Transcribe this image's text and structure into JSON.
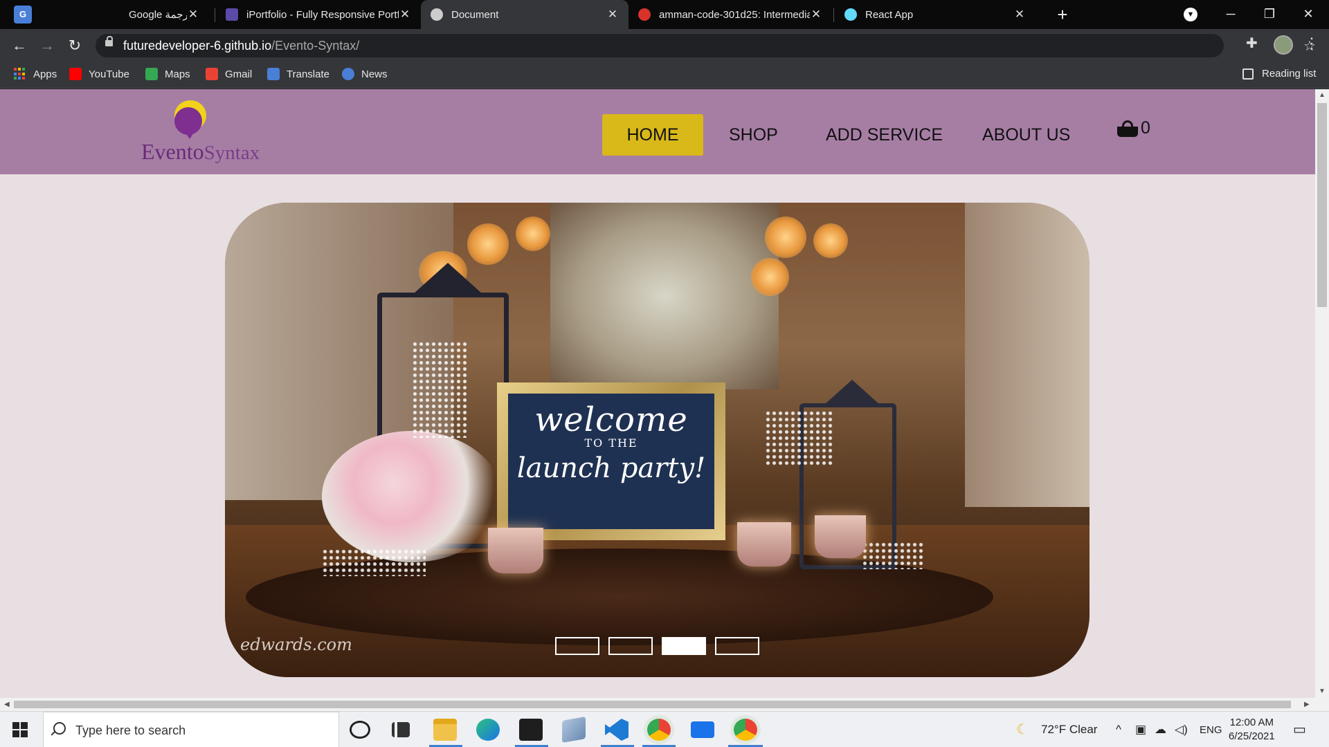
{
  "browser": {
    "tabs": [
      {
        "title": "Google ترجمة",
        "favicon": "translate-favicon",
        "color": "#4a7fd8"
      },
      {
        "title": "iPortfolio - Fully Responsive Portf",
        "favicon": "portfolio-favicon",
        "color": "#5b4aa8"
      },
      {
        "title": "Document",
        "favicon": "globe-favicon",
        "color": "#cccccc"
      },
      {
        "title": "amman-code-301d25: Intermedia",
        "favicon": "code-favicon",
        "color": "#d8322a"
      },
      {
        "title": "React App",
        "favicon": "react-favicon",
        "color": "#61dafb"
      }
    ],
    "active_tab": 2,
    "url_host": "futuredeveloper-6.github.io",
    "url_path": "/Evento-Syntax/",
    "bookmarks": [
      {
        "label": "Apps",
        "icon": "apps-grid-icon"
      },
      {
        "label": "YouTube",
        "icon": "youtube-icon",
        "color": "#ff0000"
      },
      {
        "label": "Maps",
        "icon": "maps-icon",
        "color": "#34a853"
      },
      {
        "label": "Gmail",
        "icon": "gmail-icon",
        "color": "#ea4335"
      },
      {
        "label": "Translate",
        "icon": "translate-icon",
        "color": "#4a7fd8"
      },
      {
        "label": "News",
        "icon": "news-icon",
        "color": "#4a7fd8"
      }
    ],
    "reading_list": "Reading list"
  },
  "site": {
    "logo_part1": "Evento",
    "logo_part2": "Syntax",
    "nav": [
      "HOME",
      "SHOP",
      "ADD SERVICE",
      "ABOUT US"
    ],
    "cart_count": "0",
    "colors": {
      "header": "#a67ea4",
      "active_nav": "#d9b819",
      "page_bg": "#e8dfe2"
    },
    "hero": {
      "sign_line1": "welcome",
      "sign_line2": "TO THE",
      "sign_line3": "launch party!",
      "credit": "edwards.com",
      "slide_count": 4,
      "active_slide": 2
    }
  },
  "taskbar": {
    "search_placeholder": "Type here to search",
    "weather": "72°F  Clear",
    "language": "ENG",
    "time": "12:00 AM",
    "date": "6/25/2021"
  }
}
